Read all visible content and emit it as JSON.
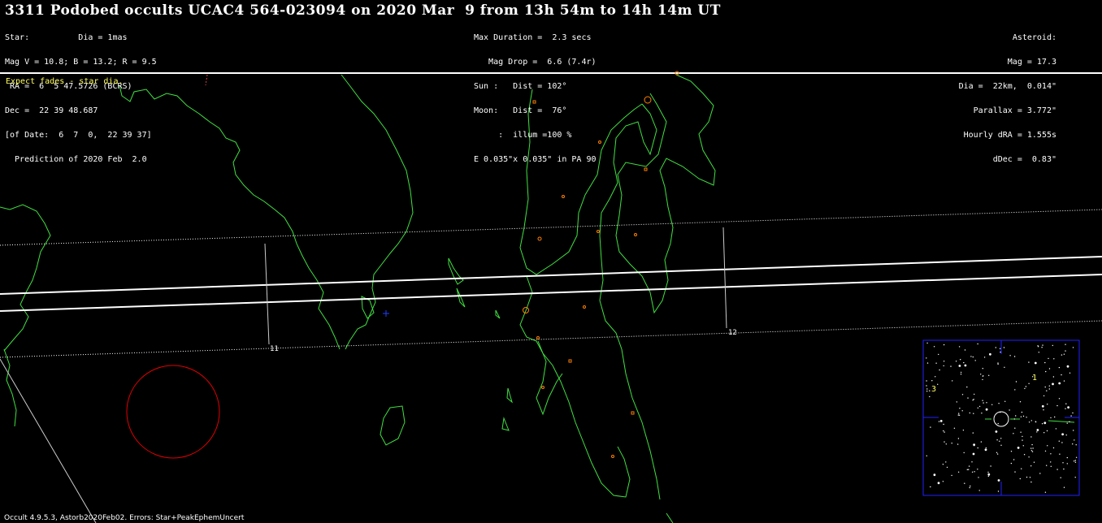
{
  "title": "3311 Podobed occults UCAC4 564-023094 on 2020 Mar  9 from 13h 54m to 14h 14m UT",
  "star": {
    "lines": [
      "Star:          Dia = 1mas",
      "Mag V = 10.8; B = 13.2; R = 9.5",
      " RA =  6  5 47.5726 (BCRS)",
      "Dec =  22 39 48.687",
      "[of Date:  6  7  0,  22 39 37]",
      "  Prediction of 2020 Feb  2.0"
    ]
  },
  "event": {
    "lines": [
      "Max Duration =  2.3 secs",
      "   Mag Drop =  6.6 (7.4r)",
      "Sun :   Dist = 102°",
      "Moon:   Dist =  76°",
      "     :  illum =100 %",
      "E 0.035\"x 0.035\" in PA 90"
    ]
  },
  "asteroid": {
    "lines": [
      "Asteroid:",
      "Mag = 17.3",
      "Dia =  22km,  0.014\"",
      "Parallax = 3.772\"",
      "Hourly dRA = 1.555s",
      "dDec =  0.83\""
    ]
  },
  "fade_note": "Expect fades - star dia.",
  "hour_labels": {
    "h11": "11",
    "h12": "12"
  },
  "inset": {
    "label_1": "1",
    "label_3": "3"
  },
  "footer": "Occult 4.9.5.3, Astorb2020Feb02. Errors: Star+PeakEphemUncert",
  "colors": {
    "coastline": "#40e040",
    "path": "#ffffff",
    "sites": "#ff8000",
    "error_circle": "#e00000",
    "inset_border": "#2020ff",
    "label_yellow": "#ffff60"
  }
}
